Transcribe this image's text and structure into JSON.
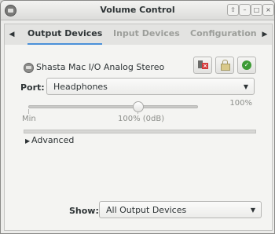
{
  "window": {
    "title": "Volume Control"
  },
  "tabs": [
    {
      "label": "Output Devices",
      "active": true
    },
    {
      "label": "Input Devices",
      "active": false
    },
    {
      "label": "Configuration",
      "active": false
    }
  ],
  "device": {
    "name": "Shasta Mac I/O Analog Stereo",
    "icon": "audio-card-icon",
    "buttons": [
      "mute-icon",
      "lock-icon",
      "default-check-icon"
    ]
  },
  "port": {
    "label": "Port:",
    "value": "Headphones"
  },
  "volume": {
    "percent_label": "100%",
    "min_label": "Min",
    "mark_label": "100% (0dB)",
    "level": 1.0
  },
  "advanced": {
    "label": "Advanced",
    "expanded": false
  },
  "show": {
    "label": "Show:",
    "value": "All Output Devices"
  },
  "colors": {
    "accent": "#4a90d9",
    "mute": "#d33b3b",
    "default": "#3d9b35"
  }
}
